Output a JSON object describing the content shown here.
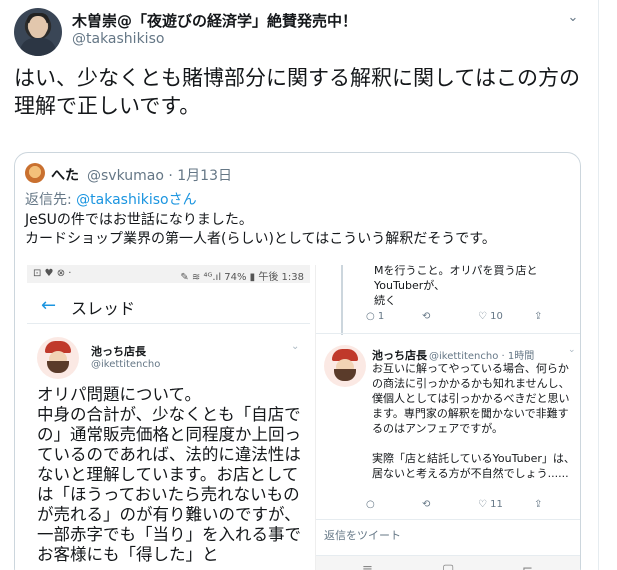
{
  "tweet": {
    "author_name": "木曽崇@「夜遊びの経済学」絶賛発売中！",
    "author_handle": "@takashikiso",
    "caret": "⌄",
    "text": "はい、少なくとも賭博部分に関する解釈に関してはこの方の理解で正しいです。"
  },
  "quote": {
    "author_name": "へた",
    "author_meta": "@svkumao · 1月13日",
    "reply_prefix": "返信先: ",
    "reply_link": "@takashikisoさん",
    "text_line1": "JeSUの件ではお世話になりました。",
    "text_line2": "カードショップ業界の第一人者(らしい)としてはこういう解釈だそうです。"
  },
  "screenshot_left": {
    "status_left": "⊡ ♥ ⊗ ·",
    "status_right": "✎ ≋ ⁴ᴳ.ıl 74% ▮ 午後 1:38",
    "back_arrow": "←",
    "header_title": "スレッド",
    "user_name": "池っち店長",
    "user_handle": "@ikettitencho",
    "caret": "⌄",
    "body": "オリパ問題について。\n中身の合計が、少なくとも「自店での」通常販売価格と同程度か上回っているのであれば、法的に違法性はないと理解しています。お店としては「ほうっておいたら売れないものが売れる」のが有り難いのですが、一部赤字でも「当り」を入れる事でお客様にも「得した」と"
  },
  "screenshot_right": {
    "top_text": "Mを行うこと。オリパを買う店とYouTuberが、\n続く",
    "actions1": {
      "reply": "○ 1",
      "retweet": "⟲",
      "like": "♡ 10",
      "share": "⇪"
    },
    "user_name": "池っち店長",
    "user_meta": "@ikettitencho · 1時間",
    "caret": "⌄",
    "body": "お互いに解ってやっている場合、何らかの商法に引っかかるかも知れませんし、僕個人としては引っかかるべきだと思います。専門家の解釈を聞かないで非難するのはアンフェアですが。\n\n実際「店と結託しているYouTuber」は、居ないと考える方が不自然でしょう......",
    "actions2": {
      "reply": "○",
      "retweet": "⟲",
      "like": "♡ 11",
      "share": "⇪"
    },
    "reply_placeholder": "返信をツイート",
    "nav": {
      "left": "≡",
      "middle": "▢",
      "right": "⌐"
    }
  }
}
